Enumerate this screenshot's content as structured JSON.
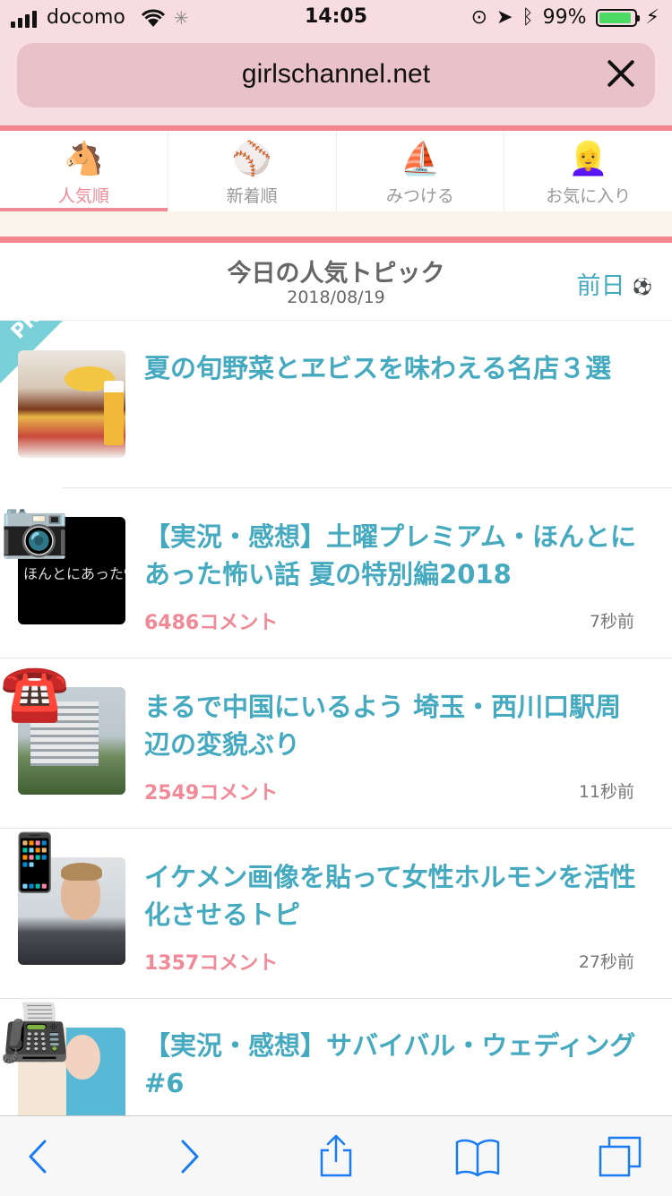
{
  "status_bar": {
    "carrier": "docomo",
    "time": "14:05",
    "battery": "99%",
    "battery_level": 0.99
  },
  "browser": {
    "url": "girlschannel.net"
  },
  "tabs": [
    {
      "label": "人気順",
      "icon": "horse-icon",
      "glyph": "🐴",
      "active": true
    },
    {
      "label": "新着順",
      "icon": "baseball-icon",
      "glyph": "⚾",
      "active": false
    },
    {
      "label": "みつける",
      "icon": "sailboat-icon",
      "glyph": "⛵",
      "active": false
    },
    {
      "label": "お気に入り",
      "icon": "girl-icon",
      "glyph": "👱‍♀️",
      "active": false
    }
  ],
  "header": {
    "title": "今日の人気トピック",
    "date": "2018/08/19",
    "prev_label": "前日",
    "prev_icon": "⚽"
  },
  "topics": [
    {
      "pr_badge": "PR",
      "title": "夏の旬野菜とヱビスを味わえる名店３選"
    },
    {
      "badge_icon": "camera-icon",
      "badge_glyph": "📷",
      "thumb_text": "ほんとにあった怖い話",
      "title": "【実況・感想】土曜プレミアム・ほんとにあった怖い話 夏の特別編2018",
      "comments": "6486コメント",
      "ago": "7秒前"
    },
    {
      "badge_icon": "telephone-icon",
      "badge_glyph": "☎️",
      "title": "まるで中国にいるよう 埼玉・西川口駅周辺の変貌ぶり",
      "comments": "2549コメント",
      "ago": "11秒前"
    },
    {
      "badge_icon": "mobile-phone-icon",
      "badge_glyph": "📱",
      "title": "イケメン画像を貼って女性ホルモンを活性化させるトピ",
      "comments": "1357コメント",
      "ago": "27秒前"
    },
    {
      "badge_icon": "fax-icon",
      "badge_glyph": "📠",
      "title": "【実況・感想】サバイバル・ウェディング#6"
    }
  ],
  "toolbar_icons": [
    "back-icon",
    "forward-icon",
    "share-icon",
    "bookmarks-icon",
    "tabs-icon"
  ],
  "colors": {
    "accent_pink": "#f08a98",
    "title_teal": "#45aabf",
    "pr_teal": "#7ad0d9",
    "header_bg": "#f7dde1"
  }
}
